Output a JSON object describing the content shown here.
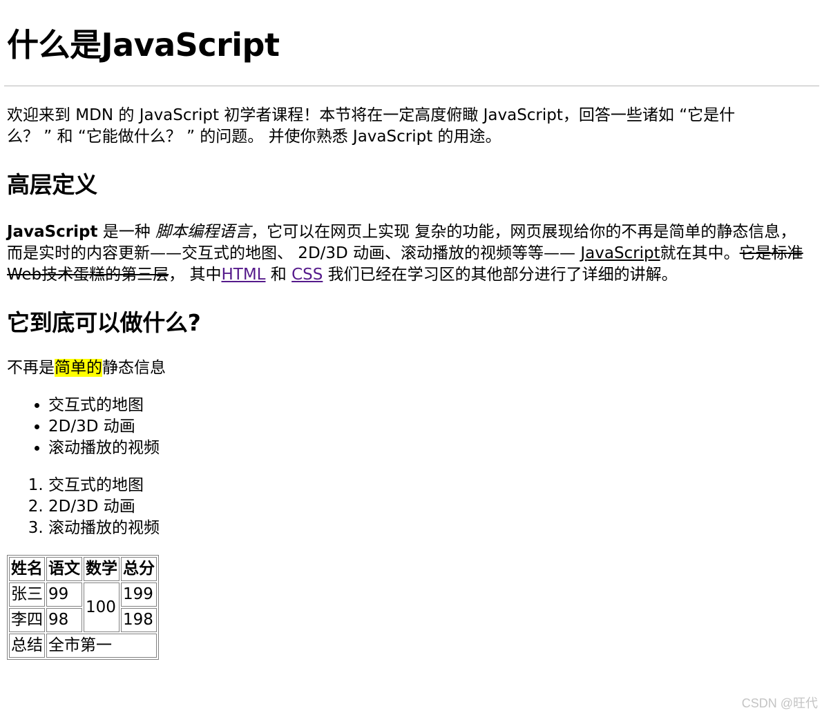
{
  "title": "什么是JavaScript",
  "intro": "欢迎来到 MDN 的 JavaScript 初学者课程！本节将在一定高度俯瞰 JavaScript，回答一些诸如 “它是什么？ ” 和 “它能做什么？ ” 的问题。 并使你熟悉 JavaScript 的用途。",
  "section1": {
    "heading": "高层定义",
    "bold": "JavaScript",
    "text1": " 是一种 ",
    "italic": "脚本编程语言",
    "text2": "，它可以在网页上实现 复杂的功能，网页展现给你的不再是简单的静态信息，而是实时的内容更新——交互式的地图、 2D/3D 动画、滚动播放的视频等等—— ",
    "underline": "JavaScript",
    "text3": "就在其中。",
    "strike": "它是标准 Web技术蛋糕的第三层",
    "text4": "， 其中",
    "link_html": "HTML",
    "text5": " 和 ",
    "link_css": "CSS",
    "text6": " 我们已经在学习区的其他部分进行了详细的讲解。"
  },
  "section2": {
    "heading": "它到底可以做什么?",
    "p_before": "不再是",
    "p_highlight": "简单的",
    "p_after": "静态信息",
    "ul": [
      "交互式的地图",
      "2D/3D 动画",
      "滚动播放的视频"
    ],
    "ol": [
      "交互式的地图",
      "2D/3D 动画",
      "滚动播放的视频"
    ]
  },
  "table": {
    "headers": [
      "姓名",
      "语文",
      "数学",
      "总分"
    ],
    "rows": [
      [
        "张三",
        "99",
        "100",
        "199"
      ],
      [
        "李四",
        "98",
        "198"
      ]
    ],
    "summary_label": "总结",
    "summary_value": "全市第一"
  },
  "watermark": "CSDN @旺代",
  "colors": {
    "highlight": "#ffff00",
    "visited_link": "#551a8b",
    "rule": "#b8b8b8",
    "watermark": "#c4c4c4"
  }
}
